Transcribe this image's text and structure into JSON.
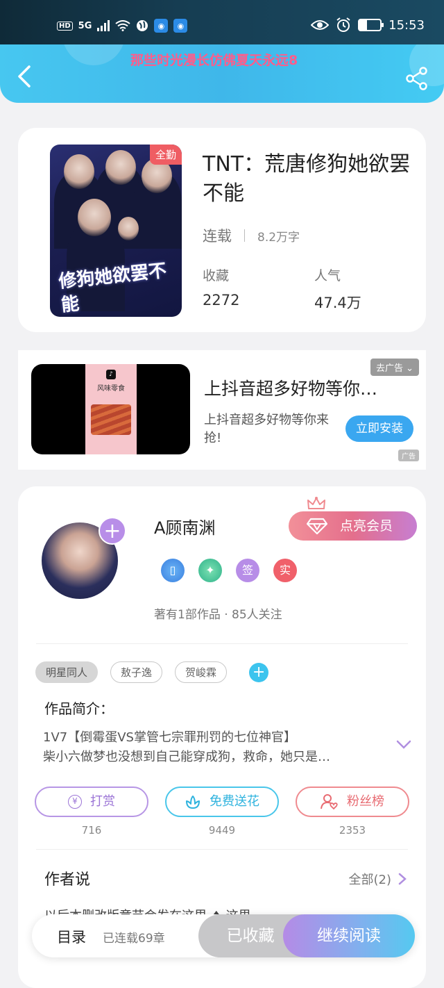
{
  "status_bar": {
    "hd": "HD",
    "network": "5G",
    "time": "15:53",
    "battery_level": 0.35
  },
  "nav": {
    "marquee": "那些时光漫长仿佛夏天永远8"
  },
  "book": {
    "badge": "全勤",
    "cover_title": "修狗她欲罢不能",
    "title": "TNT：荒唐修狗她欲罢不能",
    "status": "连载",
    "word_count": "8.2万字",
    "favorites_label": "收藏",
    "favorites_value": "2272",
    "popularity_label": "人气",
    "popularity_value": "47.4万"
  },
  "ad": {
    "product_name": "风味零食",
    "title": "上抖音超多好物等你…",
    "desc": "上抖音超多好物等你来抢!",
    "install_label": "立即安装",
    "close_label": "去广告",
    "mark_label": "广告"
  },
  "author": {
    "name": "A顾南渊",
    "vip_label": "点亮会员",
    "badges": [
      "签",
      "实"
    ],
    "stats": "著有1部作品 · 85人关注",
    "tags": [
      "明星同人",
      "敖子逸",
      "贺峻霖"
    ],
    "intro_label": "作品简介：",
    "intro_line1": "1V7【倒霉蛋VS掌管七宗罪刑罚的七位神官】",
    "intro_line2": "柴小六做梦也没想到自己能穿成狗，救命，她只是…",
    "actions": [
      {
        "label": "打赏",
        "count": "716"
      },
      {
        "label": "免费送花",
        "count": "9449"
      },
      {
        "label": "粉丝榜",
        "count": "2353"
      }
    ],
    "say_label": "作者说",
    "say_all": "全部(2)",
    "say_preview": "以后本删改版章节会发在这里 ♦ 这里 ..."
  },
  "bottom_bar": {
    "toc_label": "目录",
    "chapters": "已连载69章",
    "collected_label": "已收藏",
    "read_label": "继续阅读"
  }
}
